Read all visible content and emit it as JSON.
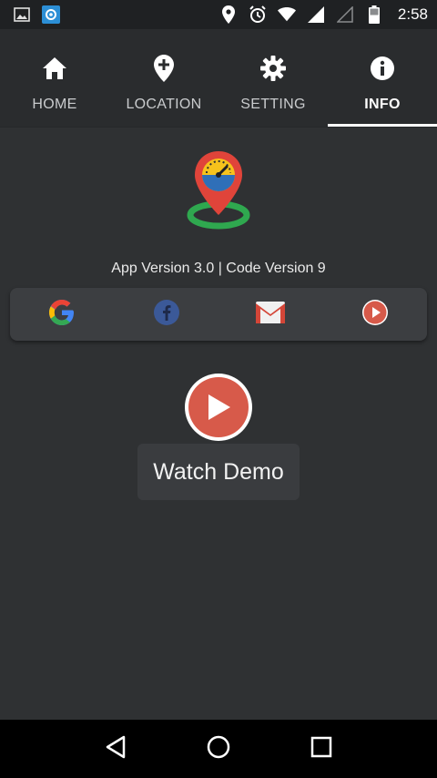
{
  "status_bar": {
    "time": "2:58",
    "icons": [
      "image-notification-icon",
      "app-notification-icon",
      "location-pin-icon",
      "alarm-icon",
      "wifi-icon",
      "signal-icon",
      "signal-empty-icon",
      "battery-icon"
    ]
  },
  "tabs": [
    {
      "label": "HOME",
      "icon": "home-icon",
      "active": false
    },
    {
      "label": "LOCATION",
      "icon": "add-location-icon",
      "active": false
    },
    {
      "label": "SETTING",
      "icon": "gear-icon",
      "active": false
    },
    {
      "label": "INFO",
      "icon": "info-icon",
      "active": true
    }
  ],
  "main": {
    "logo_icon": "speedometer-pin-logo",
    "version_text": "App Version 3.0 | Code Version 9",
    "social": [
      {
        "name": "google",
        "icon": "google-icon"
      },
      {
        "name": "facebook",
        "icon": "facebook-icon"
      },
      {
        "name": "gmail",
        "icon": "gmail-icon"
      },
      {
        "name": "youtube",
        "icon": "play-icon"
      }
    ],
    "watch_demo_label": "Watch Demo"
  },
  "nav_bar": {
    "buttons": [
      "back-icon",
      "home-circle-icon",
      "recents-icon"
    ]
  },
  "colors": {
    "background": "#2f3133",
    "tabbar": "#2a2c2e",
    "accent_red": "#d75a4a",
    "card": "#3c3e41"
  }
}
